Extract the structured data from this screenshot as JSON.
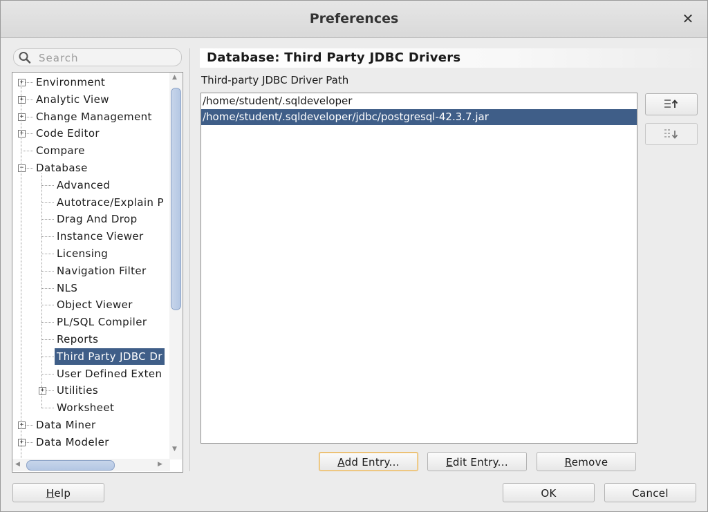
{
  "window": {
    "title": "Preferences",
    "close_glyph": "✕"
  },
  "search": {
    "placeholder": "Search"
  },
  "tree": {
    "items": [
      {
        "label": "Environment",
        "level": 0,
        "expander": "+",
        "selected": false
      },
      {
        "label": "Analytic View",
        "level": 0,
        "expander": "+",
        "selected": false
      },
      {
        "label": "Change Management P",
        "level": 0,
        "expander": "+",
        "selected": false
      },
      {
        "label": "Code Editor",
        "level": 0,
        "expander": "+",
        "selected": false
      },
      {
        "label": "Compare",
        "level": 0,
        "expander": "",
        "selected": false
      },
      {
        "label": "Database",
        "level": 0,
        "expander": "−",
        "selected": false
      },
      {
        "label": "Advanced",
        "level": 1,
        "expander": "",
        "selected": false
      },
      {
        "label": "Autotrace/Explain P",
        "level": 1,
        "expander": "",
        "selected": false
      },
      {
        "label": "Drag And Drop",
        "level": 1,
        "expander": "",
        "selected": false
      },
      {
        "label": "Instance Viewer",
        "level": 1,
        "expander": "",
        "selected": false
      },
      {
        "label": "Licensing",
        "level": 1,
        "expander": "",
        "selected": false
      },
      {
        "label": "Navigation Filter",
        "level": 1,
        "expander": "",
        "selected": false
      },
      {
        "label": "NLS",
        "level": 1,
        "expander": "",
        "selected": false
      },
      {
        "label": "Object Viewer",
        "level": 1,
        "expander": "",
        "selected": false
      },
      {
        "label": "PL/SQL Compiler",
        "level": 1,
        "expander": "",
        "selected": false
      },
      {
        "label": "Reports",
        "level": 1,
        "expander": "",
        "selected": false
      },
      {
        "label": "Third Party JDBC Dr",
        "level": 1,
        "expander": "",
        "selected": true
      },
      {
        "label": "User Defined Exten",
        "level": 1,
        "expander": "",
        "selected": false
      },
      {
        "label": "Utilities",
        "level": 1,
        "expander": "+",
        "selected": false
      },
      {
        "label": "Worksheet",
        "level": 1,
        "expander": "",
        "selected": false
      },
      {
        "label": "Data Miner",
        "level": 0,
        "expander": "+",
        "selected": false
      },
      {
        "label": "Data Modeler",
        "level": 0,
        "expander": "+",
        "selected": false
      }
    ]
  },
  "panel": {
    "header": "Database: Third Party JDBC Drivers",
    "path_label": "Third-party JDBC Driver Path",
    "entries": [
      {
        "value": "/home/student/.sqldeveloper",
        "selected": false
      },
      {
        "value": "/home/student/.sqldeveloper/jdbc/postgresql-42.3.7.jar",
        "selected": true
      }
    ],
    "move_up_icon": "move-up-icon",
    "move_down_icon": "move-down-icon"
  },
  "buttons": {
    "add_mnemonic": "A",
    "add_rest": "dd Entry...",
    "edit_mnemonic": "E",
    "edit_rest": "dit Entry...",
    "remove_mnemonic": "R",
    "remove_rest": "emove",
    "help_mnemonic": "H",
    "help_rest": "elp",
    "ok": "OK",
    "cancel": "Cancel"
  },
  "colors": {
    "selection": "#3f5e88",
    "focus_border": "#e7b35a"
  }
}
